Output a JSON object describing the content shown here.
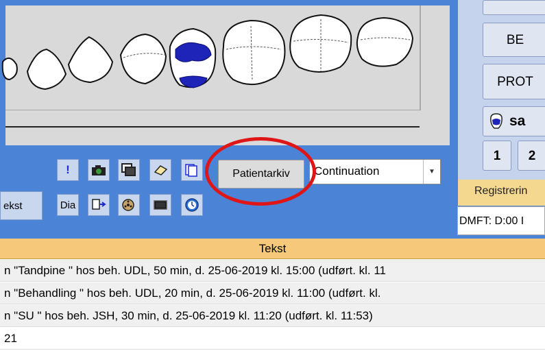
{
  "toolbar": {
    "exclaim_glyph": "!",
    "dia_label": "Dia",
    "tekst_label": "ekst",
    "patientarkiv_label": "Patientarkiv",
    "continuation_value": "Continuation"
  },
  "right_panel": {
    "be_label": "BE",
    "prot_label": "PROT",
    "sa_label": "sa",
    "num1_label": "1",
    "num2_label": "2",
    "registrering_label": "Registrerin",
    "dmft_label": "DMFT: D:00 I"
  },
  "table": {
    "header": "Tekst",
    "rows": [
      "n \"Tandpine \" hos beh. UDL, 50 min, d. 25-06-2019 kl. 15:00 (udført. kl. 11",
      "n \"Behandling \" hos beh. UDL, 20 min, d. 25-06-2019 kl. 11:00 (udført. kl.",
      "n \"SU \" hos beh. JSH, 30 min, d. 25-06-2019 kl. 11:20 (udført. kl. 11:53)",
      "21"
    ]
  },
  "colors": {
    "app_blue": "#4b84d6",
    "header_orange": "#f6c97a",
    "highlight_red": "#e01616"
  }
}
